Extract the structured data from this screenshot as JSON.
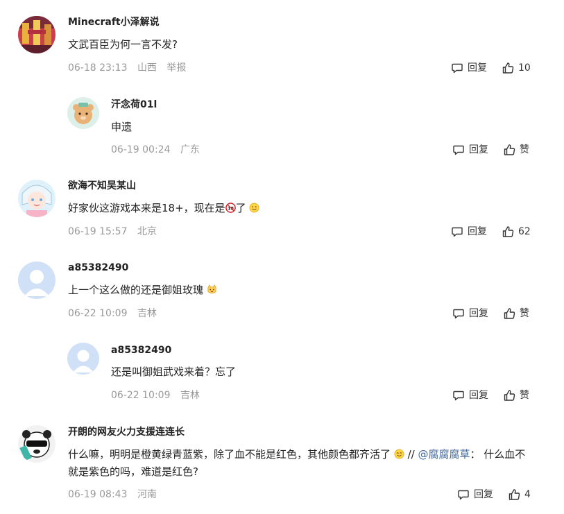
{
  "comments": [
    {
      "author": "Minecraft小泽解说",
      "text": "文武百臣为何一言不发?",
      "time": "06-18 23:13",
      "location": "山西",
      "report_label": "举报",
      "reply_label": "回复",
      "like_label": "10"
    },
    {
      "author": "汗念荷01l",
      "text": "申遗",
      "time": "06-19 00:24",
      "location": "广东",
      "reply_label": "回复",
      "like_label": "赞"
    },
    {
      "author": "欲海不知吴某山",
      "text_before": "好家伙这游戏本来是18+，现在是",
      "text_middle": "了",
      "time": "06-19 15:57",
      "location": "北京",
      "reply_label": "回复",
      "like_label": "62"
    },
    {
      "author": "a85382490",
      "text": "上一个这么做的还是御姐玫瑰",
      "time": "06-22 10:09",
      "location": "吉林",
      "reply_label": "回复",
      "like_label": "赞"
    },
    {
      "author": "a85382490",
      "text": "还是叫御姐武戏来着？忘了",
      "time": "06-22 10:09",
      "location": "吉林",
      "reply_label": "回复",
      "like_label": "赞"
    },
    {
      "author": "开朗的网友火力支援连连长",
      "text_before": "什么嘛，明明是橙黄绿青蓝紫，除了血不能是红色，其他颜色都齐活了",
      "text_sep": " // ",
      "mention": "@腐腐腐草",
      "text_after": "： 什么血不就是紫色的吗，难道是红色?",
      "time": "06-19 08:43",
      "location": "河南",
      "reply_label": "回复",
      "like_label": "4"
    }
  ],
  "icons": {
    "reply": "reply-bubble-icon",
    "like": "thumbs-up-icon",
    "age18": "no-under-18-icon",
    "smile": "smile-emoji-icon",
    "cat": "cat-emoji-icon"
  },
  "colors": {
    "meta": "#999999",
    "mention": "#406599",
    "text": "#222222"
  }
}
